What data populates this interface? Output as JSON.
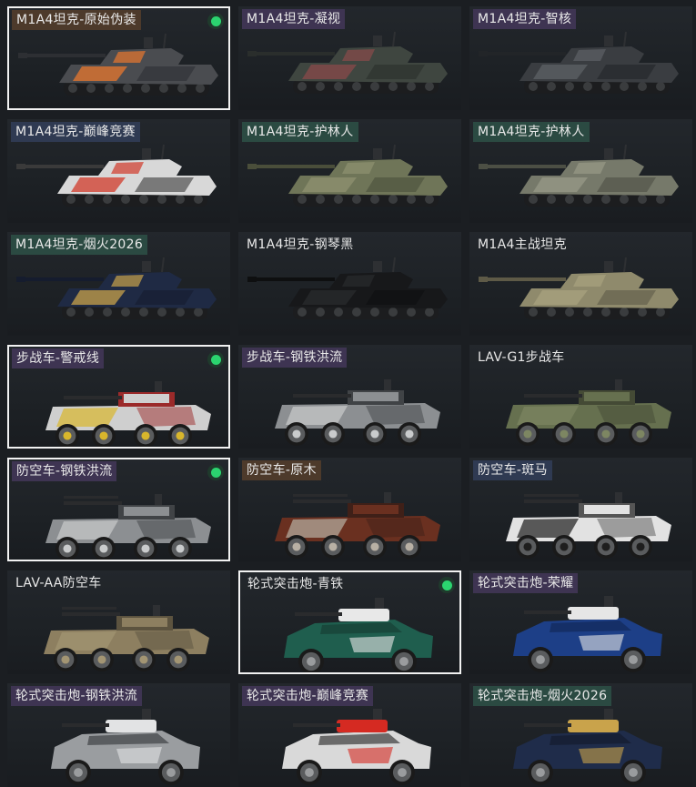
{
  "cards": [
    {
      "label": "M1A4坦克-原始伪装",
      "type": "tank",
      "tag": "orange",
      "selected": true,
      "equipped": true,
      "colors": [
        "#4a4c50",
        "#e8772e",
        "#2d2f33"
      ]
    },
    {
      "label": "M1A4坦克-凝视",
      "type": "tank",
      "tag": "purple",
      "selected": false,
      "equipped": false,
      "colors": [
        "#3f4640",
        "#8a4a4a",
        "#2a2e2c"
      ]
    },
    {
      "label": "M1A4坦克-智核",
      "type": "tank",
      "tag": "purple",
      "selected": false,
      "equipped": false,
      "colors": [
        "#3a3d41",
        "#5e6166",
        "#222528"
      ]
    },
    {
      "label": "M1A4坦克-巅峰竞赛",
      "type": "tank",
      "tag": "blue",
      "selected": false,
      "equipped": false,
      "colors": [
        "#d8d8d8",
        "#d23b2b",
        "#3a3a3a"
      ]
    },
    {
      "label": "M1A4坦克-护林人",
      "type": "tank",
      "tag": "green",
      "selected": false,
      "equipped": false,
      "colors": [
        "#6f7558",
        "#8f9270",
        "#4a4e3a"
      ]
    },
    {
      "label": "M1A4坦克-护林人",
      "type": "tank",
      "tag": "green",
      "selected": false,
      "equipped": false,
      "colors": [
        "#76796a",
        "#989a88",
        "#4c4f44"
      ]
    },
    {
      "label": "M1A4坦克-烟火2026",
      "type": "tank",
      "tag": "green",
      "selected": false,
      "equipped": false,
      "colors": [
        "#1f2a44",
        "#c8a24a",
        "#151c2e"
      ]
    },
    {
      "label": "M1A4坦克-钢琴黑",
      "type": "tank",
      "tag": "none",
      "selected": false,
      "equipped": false,
      "colors": [
        "#17181a",
        "#2a2b2e",
        "#0e0f10"
      ]
    },
    {
      "label": "M1A4主战坦克",
      "type": "tank",
      "tag": "none",
      "selected": false,
      "equipped": false,
      "colors": [
        "#8f8a6c",
        "#a8a27f",
        "#5e5a47"
      ]
    },
    {
      "label": "步战车-警戒线",
      "type": "ifv",
      "tag": "purple",
      "selected": true,
      "equipped": true,
      "colors": [
        "#cfcfcf",
        "#d8b62c",
        "#9b2a2a"
      ]
    },
    {
      "label": "步战车-钢铁洪流",
      "type": "ifv",
      "tag": "purple",
      "selected": false,
      "equipped": false,
      "colors": [
        "#8c8f92",
        "#c9cbcc",
        "#404346"
      ]
    },
    {
      "label": "LAV-G1步战车",
      "type": "ifv",
      "tag": "none",
      "selected": false,
      "equipped": false,
      "colors": [
        "#66704f",
        "#7d8662",
        "#444a35"
      ]
    },
    {
      "label": "防空车-钢铁洪流",
      "type": "aa",
      "tag": "purple",
      "selected": true,
      "equipped": true,
      "colors": [
        "#8c8f92",
        "#c9cbcc",
        "#404346"
      ]
    },
    {
      "label": "防空车-原木",
      "type": "aa",
      "tag": "orange",
      "selected": false,
      "equipped": false,
      "colors": [
        "#6a3020",
        "#b8b0a4",
        "#3f2018"
      ]
    },
    {
      "label": "防空车-斑马",
      "type": "aa",
      "tag": "blue",
      "selected": false,
      "equipped": false,
      "colors": [
        "#e2e2e2",
        "#1e1e1e",
        "#555555"
      ]
    },
    {
      "label": "LAV-AA防空车",
      "type": "aa",
      "tag": "none",
      "selected": false,
      "equipped": false,
      "colors": [
        "#8d7f60",
        "#a39573",
        "#5c533f"
      ]
    },
    {
      "label": "轮式突击炮-青铁",
      "type": "assault",
      "tag": "none",
      "selected": true,
      "equipped": true,
      "colors": [
        "#1f5e4e",
        "#e8e8e8",
        "#173f35"
      ]
    },
    {
      "label": "轮式突击炮-荣耀",
      "type": "assault",
      "tag": "purple",
      "selected": false,
      "equipped": false,
      "colors": [
        "#1d3f87",
        "#e6e6e6",
        "#132a5a"
      ]
    },
    {
      "label": "轮式突击炮-钢铁洪流",
      "type": "assault",
      "tag": "purple",
      "selected": false,
      "equipped": false,
      "colors": [
        "#9a9da0",
        "#e2e3e4",
        "#3e4144"
      ]
    },
    {
      "label": "轮式突击炮-巅峰竞赛",
      "type": "assault",
      "tag": "purple",
      "selected": false,
      "equipped": false,
      "colors": [
        "#d9d9d9",
        "#d52a22",
        "#3a3a3a"
      ]
    },
    {
      "label": "轮式突击炮-烟火2026",
      "type": "assault",
      "tag": "green",
      "selected": false,
      "equipped": false,
      "colors": [
        "#1f2c4a",
        "#c9a34b",
        "#141b2e"
      ]
    }
  ]
}
